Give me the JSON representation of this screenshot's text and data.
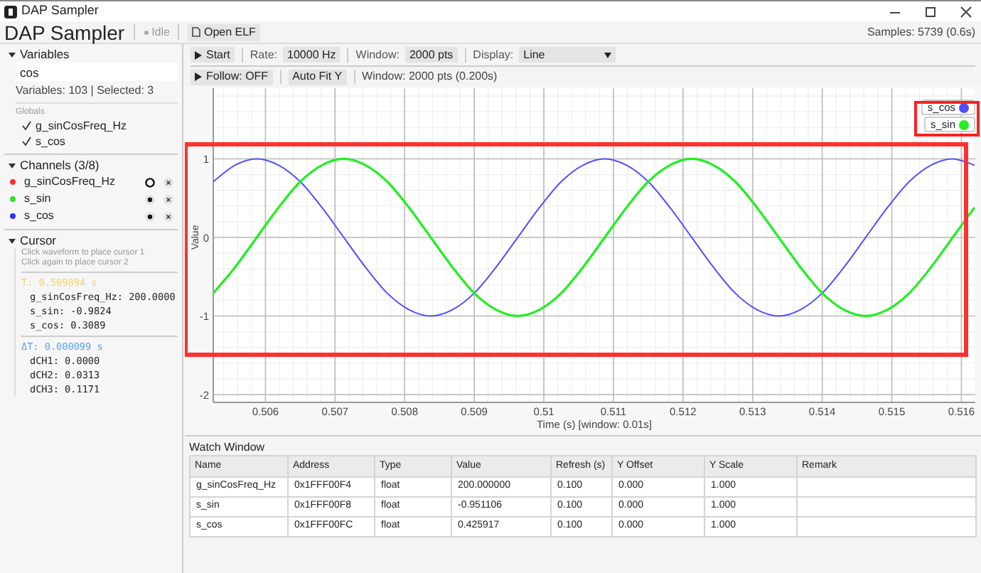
{
  "window": {
    "title": "DAP Sampler"
  },
  "header": {
    "app_name": "DAP Sampler",
    "status": "Idle",
    "open_button": "Open ELF",
    "samples": "Samples: 5739 (0.6s)"
  },
  "variables": {
    "title": "Variables",
    "expanded": true,
    "search": "cos",
    "summary": "Variables: 103 | Selected: 3",
    "group": "Globals",
    "items": [
      {
        "name": "g_sinCosFreq_Hz",
        "checked": true
      },
      {
        "name": "s_cos",
        "checked": true
      }
    ]
  },
  "channels": {
    "title": "Channels (3/8)",
    "expanded": true,
    "items": [
      {
        "name": "g_sinCosFreq_Hz",
        "color": "#ff3030",
        "plotted": false
      },
      {
        "name": "s_sin",
        "color": "#30e030",
        "plotted": true
      },
      {
        "name": "s_cos",
        "color": "#3030ff",
        "plotted": true
      }
    ]
  },
  "cursor": {
    "title": "Cursor",
    "expanded": true,
    "hints": [
      "Click waveform to place cursor 1",
      "Click again to place cursor 2"
    ],
    "t": "T: 0.509894 s",
    "values": [
      "g_sinCosFreq_Hz: 200.0000",
      "s_sin: -0.9824",
      "s_cos: 0.3089"
    ],
    "dt": "ΔT: 0.000099 s",
    "deltas": [
      "dCH1: 0.0000",
      "dCH2: 0.0313",
      "dCH3: 0.1171"
    ]
  },
  "toolbar": {
    "start": "Start",
    "rate_label": "Rate:",
    "rate": "10000 Hz",
    "window_label": "Window:",
    "window": "2000 pts",
    "display_label": "Display:",
    "display": "Line",
    "follow": "Follow: OFF",
    "autofit": "Auto Fit Y",
    "window_info": "Window: 2000 pts (0.200s)"
  },
  "chart": {
    "chart_data": {
      "type": "line",
      "xlabel": "Time (s) [window: 0.01s]",
      "ylabel": "Value",
      "xlim": [
        0.50525,
        0.5162
      ],
      "grid": true,
      "legend": true,
      "ylim": [
        -2.1,
        1.9
      ],
      "xticks": [
        0.506,
        0.507,
        0.508,
        0.509,
        {
          "value": 0.51,
          "label": "0.51"
        },
        0.511,
        0.512,
        0.513,
        0.514,
        0.515,
        0.516
      ],
      "yticks": [
        -2,
        -1,
        0,
        1
      ],
      "x": [
        0.50525,
        0.5055625,
        0.505875,
        0.5061875,
        0.5065,
        0.5068125,
        0.507125,
        0.5074375,
        0.50775,
        0.5080625,
        0.508375,
        0.5086875,
        0.509,
        0.5093125,
        0.509625,
        0.5099375,
        0.51025,
        0.5105625,
        0.510875,
        0.5111875,
        0.5115,
        0.5118125,
        0.512125,
        0.5124375,
        0.51275,
        0.5130625,
        0.513375,
        0.5136875,
        0.514,
        0.5143125,
        0.514625,
        0.5149375,
        0.51525,
        0.5155625,
        0.515875,
        0.5161875
      ],
      "series": [
        {
          "name": "s_cos",
          "color": "#5050ff",
          "values": [
            0.71,
            0.92,
            1,
            0.92,
            0.71,
            0.38,
            0,
            -0.38,
            -0.71,
            -0.92,
            -1,
            -0.92,
            -0.71,
            -0.38,
            0,
            0.38,
            0.71,
            0.92,
            1,
            0.92,
            0.71,
            0.38,
            0,
            -0.38,
            -0.71,
            -0.92,
            -1,
            -0.92,
            -0.71,
            -0.38,
            0,
            0.38,
            0.71,
            0.92,
            1,
            0.92
          ]
        },
        {
          "name": "s_sin",
          "color": "#22ee22",
          "values": [
            -0.71,
            -0.38,
            0,
            0.38,
            0.71,
            0.92,
            1,
            0.92,
            0.71,
            0.38,
            0,
            -0.38,
            -0.71,
            -0.92,
            -1,
            -0.92,
            -0.71,
            -0.38,
            0,
            0.38,
            0.71,
            0.92,
            1,
            0.92,
            0.71,
            0.38,
            0,
            -0.38,
            -0.71,
            -0.92,
            -1,
            -0.92,
            -0.71,
            -0.38,
            0,
            0.38
          ]
        }
      ]
    }
  },
  "watch": {
    "title": "Watch Window",
    "columns": [
      "Name",
      "Address",
      "Type",
      "Value",
      "Refresh (s)",
      "Y Offset",
      "Y Scale",
      "Remark"
    ],
    "rows": [
      [
        "g_sinCosFreq_Hz",
        "0x1FFF00F4",
        "float",
        "200.000000",
        "0.100",
        "0.000",
        "1.000"
      ],
      [
        "s_sin",
        "0x1FFF00F8",
        "float",
        "-0.951106",
        "0.100",
        "0.000",
        "1.000"
      ],
      [
        "s_cos",
        "0x1FFF00FC",
        "float",
        "0.425917",
        "0.100",
        "0.000",
        "1.000"
      ]
    ]
  }
}
